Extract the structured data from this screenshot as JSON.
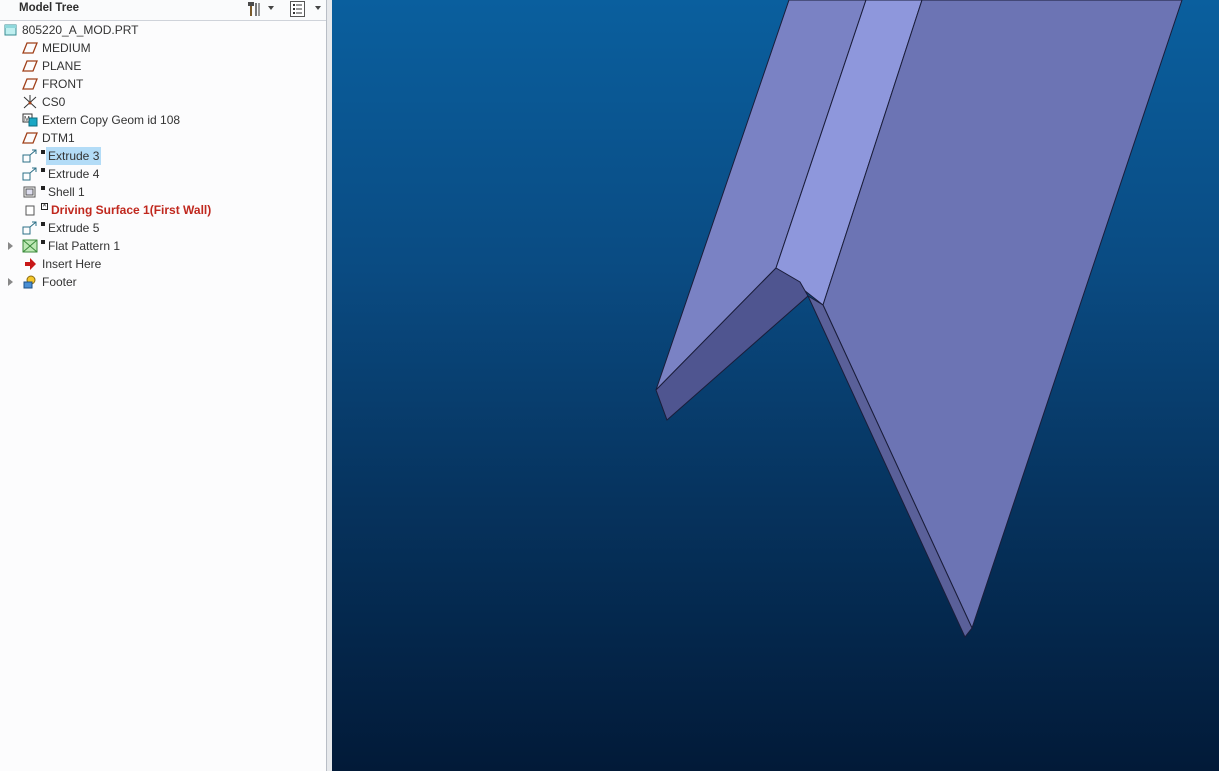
{
  "model_tree": {
    "title": "Model Tree",
    "toolbar": {
      "settings_icon": "hammer-icon",
      "show_icon": "list-icon"
    },
    "items": [
      {
        "label": "805220_A_MOD.PRT",
        "icon": "part-icon"
      },
      {
        "label": "MEDIUM",
        "icon": "datum-plane-icon"
      },
      {
        "label": "PLANE",
        "icon": "datum-plane-icon"
      },
      {
        "label": "FRONT",
        "icon": "datum-plane-icon"
      },
      {
        "label": "CS0",
        "icon": "coordinate-system-icon"
      },
      {
        "label": "Extern Copy Geom id 108",
        "icon": "copy-geom-icon"
      },
      {
        "label": "DTM1",
        "icon": "datum-plane-icon"
      },
      {
        "label": "Extrude 3",
        "icon": "extrude-icon",
        "selected": true
      },
      {
        "label": "Extrude 4",
        "icon": "extrude-icon"
      },
      {
        "label": "Shell 1",
        "icon": "shell-icon"
      },
      {
        "label": "Driving Surface 1(First Wall)",
        "icon": "surface-icon",
        "error": true
      },
      {
        "label": "Extrude 5",
        "icon": "extrude-icon"
      },
      {
        "label": "Flat Pattern 1",
        "icon": "flat-pattern-icon",
        "expandable": true
      },
      {
        "label": "Insert Here",
        "icon": "insert-arrow-icon"
      },
      {
        "label": "Footer",
        "icon": "footer-icon",
        "expandable": true
      }
    ]
  },
  "viewport": {
    "background_top": "#0a5f9e",
    "background_bottom": "#021a38",
    "part_face_color": "#6c74b4",
    "part_edge_color": "#4f5590"
  }
}
